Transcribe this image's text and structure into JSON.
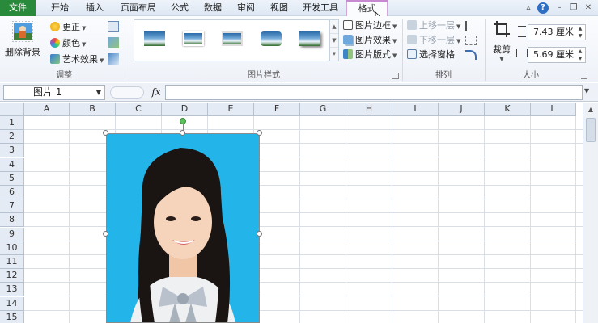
{
  "tabs": [
    {
      "label": "文件"
    },
    {
      "label": "开始"
    },
    {
      "label": "插入"
    },
    {
      "label": "页面布局"
    },
    {
      "label": "公式"
    },
    {
      "label": "数据"
    },
    {
      "label": "审阅"
    },
    {
      "label": "视图"
    },
    {
      "label": "开发工具"
    },
    {
      "label": "格式"
    }
  ],
  "window_controls": {
    "minimize_ribbon": "▵",
    "help": "?",
    "minimize": "–",
    "restore": "❐",
    "close": "✕"
  },
  "ribbon": {
    "adjust": {
      "remove_bg": "删除背景",
      "corrections": "更正",
      "color": "颜色",
      "artistic": "艺术效果",
      "label": "调整"
    },
    "styles": {
      "border": "图片边框",
      "effects": "图片效果",
      "layout": "图片版式",
      "label": "图片样式"
    },
    "arrange": {
      "bring_forward": "上移一层",
      "send_backward": "下移一层",
      "selection_pane": "选择窗格",
      "label": "排列"
    },
    "size": {
      "crop": "裁剪",
      "height": "7.43 厘米",
      "width": "5.69 厘米",
      "label": "大小"
    }
  },
  "formula_bar": {
    "name_box": "图片 1",
    "fx": "fx",
    "formula": ""
  },
  "grid": {
    "columns": [
      "A",
      "B",
      "C",
      "D",
      "E",
      "F",
      "G",
      "H",
      "I",
      "J",
      "K",
      "L"
    ],
    "rows": [
      "1",
      "2",
      "3",
      "4",
      "5",
      "6",
      "7",
      "8",
      "9",
      "10",
      "11",
      "12",
      "13",
      "14",
      "15"
    ]
  },
  "colors": {
    "file_tab": "#2a8a3c",
    "context_tab": "#c78ad1",
    "photo_bg": "#23b4ea"
  },
  "icons": [
    "remove-background-icon",
    "corrections-icon",
    "color-icon",
    "artistic-effects-icon",
    "compress-icon",
    "change-picture-icon",
    "reset-picture-icon",
    "border-icon",
    "effects-icon",
    "layout-icon",
    "bring-forward-icon",
    "send-backward-icon",
    "selection-pane-icon",
    "align-icon",
    "group-icon",
    "rotate-icon",
    "crop-icon",
    "height-icon",
    "width-icon",
    "help-icon"
  ]
}
